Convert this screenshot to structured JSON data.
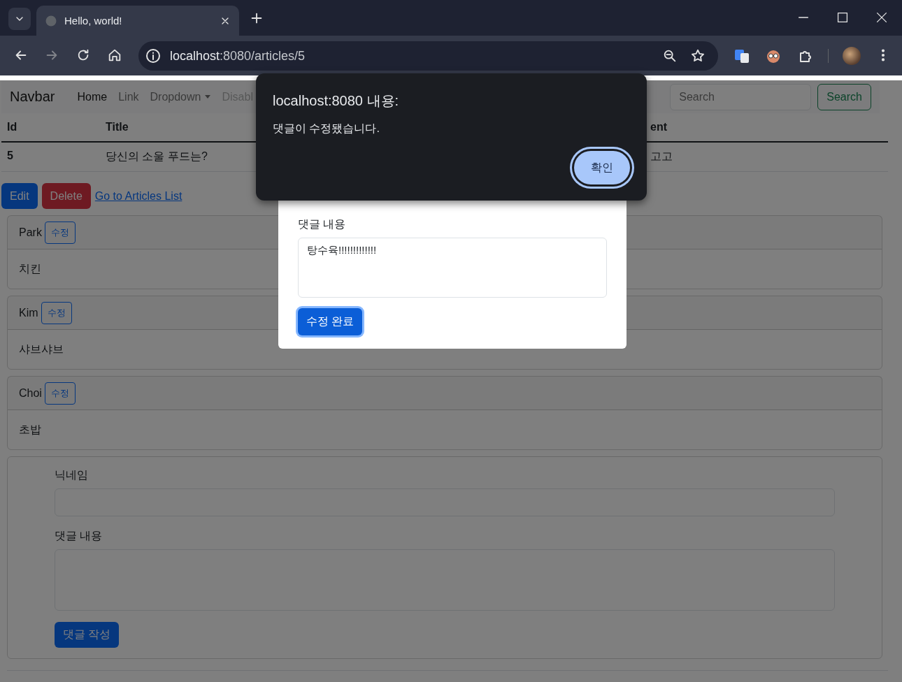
{
  "browser": {
    "tab_title": "Hello, world!",
    "url_host": "localhost",
    "url_path": ":8080/articles/5"
  },
  "navbar": {
    "brand": "Navbar",
    "items": [
      {
        "label": "Home",
        "selected": true,
        "disabled": false,
        "dropdown": false
      },
      {
        "label": "Link",
        "selected": false,
        "disabled": false,
        "dropdown": false
      },
      {
        "label": "Dropdown",
        "selected": false,
        "disabled": false,
        "dropdown": true
      },
      {
        "label": "Disabl",
        "selected": false,
        "disabled": true,
        "dropdown": false
      }
    ],
    "search": {
      "placeholder": "Search",
      "button": "Search"
    }
  },
  "table": {
    "columns": [
      "Id",
      "Title",
      "ent"
    ],
    "rows": [
      [
        "5",
        "당신의 소울 푸드는?",
        "고고"
      ]
    ]
  },
  "actions": {
    "edit": "Edit",
    "delete": "Delete",
    "link": "Go to Articles List"
  },
  "comments": [
    {
      "nickname": "Park",
      "edit_button": "수정",
      "body": "치킨"
    },
    {
      "nickname": "Kim",
      "edit_button": "수정",
      "body": "샤브샤브"
    },
    {
      "nickname": "Choi",
      "edit_button": "수정",
      "body": "초밥"
    }
  ],
  "comment_form": {
    "nickname_label": "닉네임",
    "body_label": "댓글 내용",
    "submit": "댓글 작성"
  },
  "edit_modal": {
    "body_label": "댓글 내용",
    "body_value": "탕수육!!!!!!!!!!!!!",
    "submit": "수정 완료"
  },
  "alert": {
    "title": "localhost:8080 내용:",
    "message": "댓글이 수정됐습니다.",
    "ok_button": "확인"
  }
}
